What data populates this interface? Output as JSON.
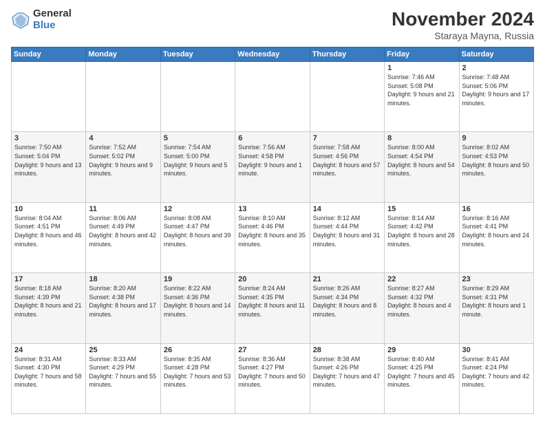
{
  "logo": {
    "general": "General",
    "blue": "Blue"
  },
  "title": {
    "month": "November 2024",
    "location": "Staraya Mayna, Russia"
  },
  "weekdays": [
    "Sunday",
    "Monday",
    "Tuesday",
    "Wednesday",
    "Thursday",
    "Friday",
    "Saturday"
  ],
  "weeks": [
    [
      {
        "day": "",
        "info": ""
      },
      {
        "day": "",
        "info": ""
      },
      {
        "day": "",
        "info": ""
      },
      {
        "day": "",
        "info": ""
      },
      {
        "day": "",
        "info": ""
      },
      {
        "day": "1",
        "info": "Sunrise: 7:46 AM\nSunset: 5:08 PM\nDaylight: 9 hours\nand 21 minutes."
      },
      {
        "day": "2",
        "info": "Sunrise: 7:48 AM\nSunset: 5:06 PM\nDaylight: 9 hours\nand 17 minutes."
      }
    ],
    [
      {
        "day": "3",
        "info": "Sunrise: 7:50 AM\nSunset: 5:04 PM\nDaylight: 9 hours\nand 13 minutes."
      },
      {
        "day": "4",
        "info": "Sunrise: 7:52 AM\nSunset: 5:02 PM\nDaylight: 9 hours\nand 9 minutes."
      },
      {
        "day": "5",
        "info": "Sunrise: 7:54 AM\nSunset: 5:00 PM\nDaylight: 9 hours\nand 5 minutes."
      },
      {
        "day": "6",
        "info": "Sunrise: 7:56 AM\nSunset: 4:58 PM\nDaylight: 9 hours\nand 1 minute."
      },
      {
        "day": "7",
        "info": "Sunrise: 7:58 AM\nSunset: 4:56 PM\nDaylight: 8 hours\nand 57 minutes."
      },
      {
        "day": "8",
        "info": "Sunrise: 8:00 AM\nSunset: 4:54 PM\nDaylight: 8 hours\nand 54 minutes."
      },
      {
        "day": "9",
        "info": "Sunrise: 8:02 AM\nSunset: 4:53 PM\nDaylight: 8 hours\nand 50 minutes."
      }
    ],
    [
      {
        "day": "10",
        "info": "Sunrise: 8:04 AM\nSunset: 4:51 PM\nDaylight: 8 hours\nand 46 minutes."
      },
      {
        "day": "11",
        "info": "Sunrise: 8:06 AM\nSunset: 4:49 PM\nDaylight: 8 hours\nand 42 minutes."
      },
      {
        "day": "12",
        "info": "Sunrise: 8:08 AM\nSunset: 4:47 PM\nDaylight: 8 hours\nand 39 minutes."
      },
      {
        "day": "13",
        "info": "Sunrise: 8:10 AM\nSunset: 4:46 PM\nDaylight: 8 hours\nand 35 minutes."
      },
      {
        "day": "14",
        "info": "Sunrise: 8:12 AM\nSunset: 4:44 PM\nDaylight: 8 hours\nand 31 minutes."
      },
      {
        "day": "15",
        "info": "Sunrise: 8:14 AM\nSunset: 4:42 PM\nDaylight: 8 hours\nand 28 minutes."
      },
      {
        "day": "16",
        "info": "Sunrise: 8:16 AM\nSunset: 4:41 PM\nDaylight: 8 hours\nand 24 minutes."
      }
    ],
    [
      {
        "day": "17",
        "info": "Sunrise: 8:18 AM\nSunset: 4:39 PM\nDaylight: 8 hours\nand 21 minutes."
      },
      {
        "day": "18",
        "info": "Sunrise: 8:20 AM\nSunset: 4:38 PM\nDaylight: 8 hours\nand 17 minutes."
      },
      {
        "day": "19",
        "info": "Sunrise: 8:22 AM\nSunset: 4:36 PM\nDaylight: 8 hours\nand 14 minutes."
      },
      {
        "day": "20",
        "info": "Sunrise: 8:24 AM\nSunset: 4:35 PM\nDaylight: 8 hours\nand 11 minutes."
      },
      {
        "day": "21",
        "info": "Sunrise: 8:26 AM\nSunset: 4:34 PM\nDaylight: 8 hours\nand 8 minutes."
      },
      {
        "day": "22",
        "info": "Sunrise: 8:27 AM\nSunset: 4:32 PM\nDaylight: 8 hours\nand 4 minutes."
      },
      {
        "day": "23",
        "info": "Sunrise: 8:29 AM\nSunset: 4:31 PM\nDaylight: 8 hours\nand 1 minute."
      }
    ],
    [
      {
        "day": "24",
        "info": "Sunrise: 8:31 AM\nSunset: 4:30 PM\nDaylight: 7 hours\nand 58 minutes."
      },
      {
        "day": "25",
        "info": "Sunrise: 8:33 AM\nSunset: 4:29 PM\nDaylight: 7 hours\nand 55 minutes."
      },
      {
        "day": "26",
        "info": "Sunrise: 8:35 AM\nSunset: 4:28 PM\nDaylight: 7 hours\nand 53 minutes."
      },
      {
        "day": "27",
        "info": "Sunrise: 8:36 AM\nSunset: 4:27 PM\nDaylight: 7 hours\nand 50 minutes."
      },
      {
        "day": "28",
        "info": "Sunrise: 8:38 AM\nSunset: 4:26 PM\nDaylight: 7 hours\nand 47 minutes."
      },
      {
        "day": "29",
        "info": "Sunrise: 8:40 AM\nSunset: 4:25 PM\nDaylight: 7 hours\nand 45 minutes."
      },
      {
        "day": "30",
        "info": "Sunrise: 8:41 AM\nSunset: 4:24 PM\nDaylight: 7 hours\nand 42 minutes."
      }
    ]
  ]
}
